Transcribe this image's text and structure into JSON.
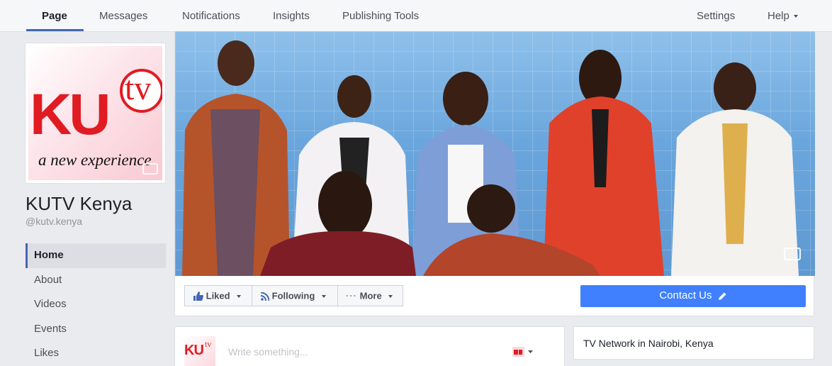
{
  "nav": {
    "tabs": [
      {
        "label": "Page"
      },
      {
        "label": "Messages"
      },
      {
        "label": "Notifications"
      },
      {
        "label": "Insights"
      },
      {
        "label": "Publishing Tools"
      }
    ],
    "settings": "Settings",
    "help": "Help"
  },
  "profile": {
    "logo_ku": "KU",
    "logo_tv": "tv",
    "logo_tagline": "a new experience",
    "name": "KUTV Kenya",
    "handle": "@kutv.kenya"
  },
  "sidebar": {
    "items": [
      {
        "label": "Home"
      },
      {
        "label": "About"
      },
      {
        "label": "Videos"
      },
      {
        "label": "Events"
      },
      {
        "label": "Likes"
      }
    ]
  },
  "actions": {
    "liked": "Liked",
    "following": "Following",
    "more": "More",
    "contact": "Contact Us"
  },
  "composer": {
    "placeholder": "Write something..."
  },
  "about": {
    "category": "TV Network in Nairobi, Kenya"
  },
  "colors": {
    "brand_blue": "#4267b2",
    "contact_blue": "#4080ff",
    "logo_red": "#e11b22"
  }
}
